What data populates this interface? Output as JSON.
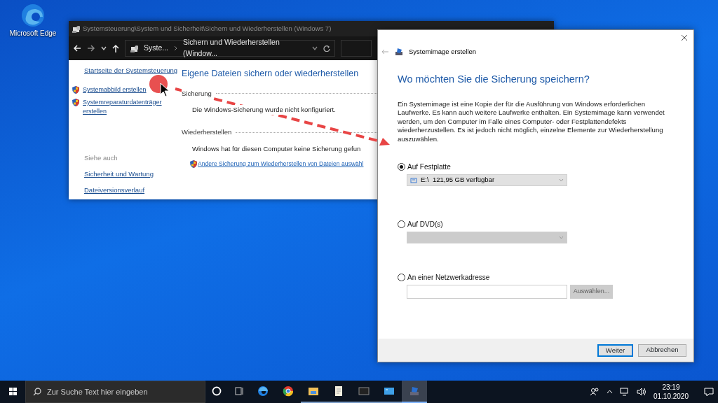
{
  "desktop": {
    "icons": [
      {
        "label": "Microsoft Edge"
      }
    ]
  },
  "control_panel": {
    "title": "Systemsteuerung\\System und Sicherheit\\Sichern und Wiederherstellen (Windows 7)",
    "breadcrumb": [
      "Syste...",
      "Sichern und Wiederherstellen (Window..."
    ],
    "sidebar": {
      "home_link": "Startseite der Systemsteuerung",
      "tasks": [
        "Systemabbild erstellen",
        "Systemreparaturdatenträger erstellen"
      ],
      "see_also_label": "Siehe auch",
      "links": [
        "Sicherheit und Wartung",
        "Dateiversionsverlauf"
      ]
    },
    "heading": "Eigene Dateien sichern oder wiederherstellen",
    "sections": [
      {
        "title": "Sicherung",
        "text": "Die Windows-Sicherung wurde nicht konfiguriert."
      },
      {
        "title": "Wiederherstellen",
        "text": "Windows hat für diesen Computer keine Sicherung gefun",
        "link": "Andere Sicherung zum Wiederherstellen von Dateien auswähl"
      }
    ]
  },
  "dialog": {
    "title": "Systemimage erstellen",
    "heading": "Wo möchten Sie die Sicherung speichern?",
    "description": "Ein Systemimage ist eine Kopie der für die Ausführung von Windows erforderlichen Laufwerke. Es kann auch weitere Laufwerke enthalten. Ein Systemimage kann verwendet werden, um den Computer im Falle eines Computer- oder Festplattendefekts wiederherzustellen. Es ist jedoch nicht möglich, einzelne Elemente zur Wiederherstellung auszuwählen.",
    "options": [
      {
        "kind": "dropdown",
        "label": "Auf Festplatte",
        "selected": true,
        "disabled": false,
        "value": "E:\\  121,95 GB verfügbar"
      },
      {
        "kind": "dropdown",
        "label": "Auf DVD(s)",
        "selected": false,
        "disabled": true
      },
      {
        "kind": "address",
        "label": "An einer Netzwerkadresse",
        "selected": false,
        "button": "Auswählen..."
      }
    ],
    "buttons": [
      {
        "label": "Weiter",
        "default": true
      },
      {
        "label": "Abbrechen",
        "default": false
      }
    ]
  },
  "taskbar": {
    "search_placeholder": "Zur Suche Text hier eingeben",
    "apps": [
      {
        "running": false,
        "selected": false
      },
      {
        "running": false,
        "selected": false
      },
      {
        "running": false,
        "selected": false
      },
      {
        "running": false,
        "selected": false
      },
      {
        "running": true,
        "selected": false
      },
      {
        "running": true,
        "selected": false
      },
      {
        "running": true,
        "selected": false
      },
      {
        "running": true,
        "selected": false
      },
      {
        "running": true,
        "selected": true
      }
    ],
    "clock": {
      "time": "23:19",
      "date": "01.10.2020"
    }
  }
}
